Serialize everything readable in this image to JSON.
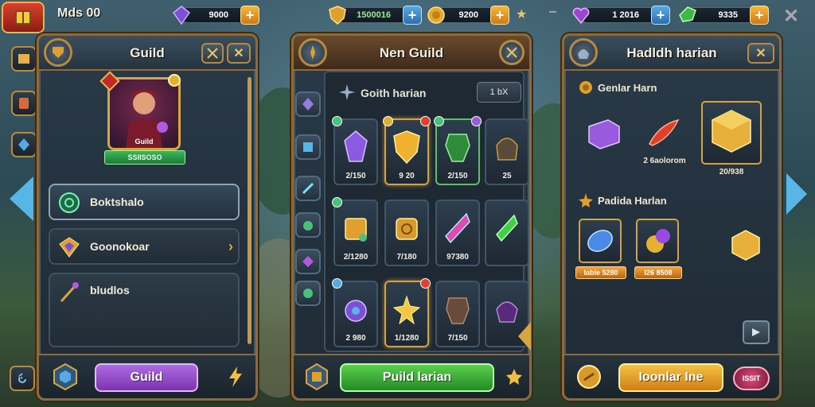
{
  "player": {
    "name": "Mds 00"
  },
  "resources": [
    {
      "icon": "purple-gem-icon",
      "value": "9000",
      "plus": "+"
    },
    {
      "icon": "gold-shield-icon",
      "value": "1500016",
      "plus": "+"
    },
    {
      "icon": "gold-coin-icon",
      "value": "9200",
      "plus": "+"
    },
    {
      "icon": "purple-heart-gem-icon",
      "value": "1 2016",
      "plus": "+"
    },
    {
      "icon": "green-gem-icon",
      "value": "9335",
      "plus": "+"
    }
  ],
  "guild_panel": {
    "title": "Guild",
    "portrait_name": "Guild",
    "portrait_label": "SSIISOSO",
    "menu": [
      {
        "label": "Boktshalo",
        "icon": "emblem-icon"
      },
      {
        "label": "Goonokoar",
        "icon": "purple-gem-icon"
      },
      {
        "label": "bludlos",
        "icon": "staff-icon"
      }
    ],
    "footer_button": "Guild"
  },
  "inventory_panel": {
    "title": "Nen Guild",
    "subheader": "Goith harian",
    "chip": "1 bX",
    "items": [
      {
        "icon": "purple-crystal-icon",
        "value": "2/150"
      },
      {
        "icon": "gold-shield-icon",
        "value": "9 20"
      },
      {
        "icon": "green-armor-icon",
        "value": "2/150"
      },
      {
        "icon": "dark-helm-icon",
        "value": "25"
      },
      {
        "icon": "gold-box-icon",
        "value": "2/1280"
      },
      {
        "icon": "gold-rune-icon",
        "value": "7/180"
      },
      {
        "icon": "rainbow-crystal-icon",
        "value": "97380"
      },
      {
        "icon": "green-shard-icon",
        "value": ""
      },
      {
        "icon": "purple-orb-icon",
        "value": "2 980"
      },
      {
        "icon": "gold-star-icon",
        "value": "1/1280"
      },
      {
        "icon": "brown-armor-icon",
        "value": "7/150"
      },
      {
        "icon": "purple-orb-icon",
        "value": ""
      }
    ],
    "footer_button": "Puild larian"
  },
  "harvest_panel": {
    "title": "Hadldh harian",
    "section1": "Genlar Harn",
    "section1_value": "2 6aolorom",
    "section1_tile_value": "20/938",
    "section2": "Padida Harlan",
    "section2_tags": [
      "Iabie 5280",
      "I26 8508"
    ],
    "footer_button": "Ioonlar Ine",
    "footer_badge": "ISSIT"
  },
  "colors": {
    "accent_gold": "#d8a640",
    "panel_bg": "#1e2a35",
    "green_button": "#3fbf45",
    "purple_button": "#9a46cf",
    "orange_button": "#f0a820"
  }
}
